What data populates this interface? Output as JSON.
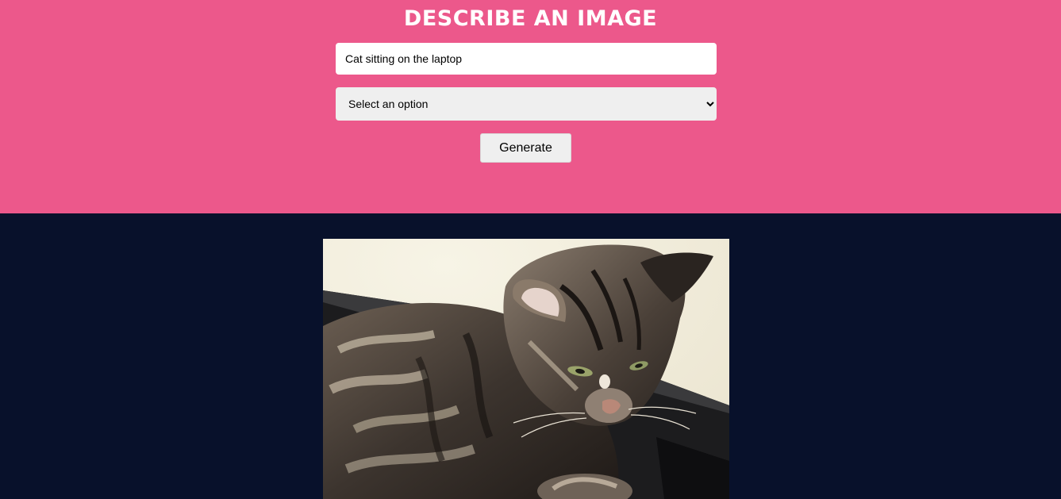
{
  "header": {
    "title": "DESCRIBE AN IMAGE",
    "background_color": "#ec588b"
  },
  "form": {
    "prompt_value": "Cat sitting on the laptop",
    "select_selected": "Select an option",
    "select_options": [
      "Select an option"
    ],
    "generate_label": "Generate"
  },
  "result": {
    "background_color": "#08112b",
    "image_subject": "cat-on-laptop-image"
  }
}
